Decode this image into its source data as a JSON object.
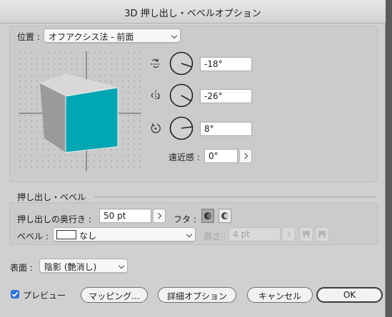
{
  "window": {
    "title": "3D 押し出し・ベベルオプション"
  },
  "position": {
    "label": "位置 :",
    "preset": "オフアクシス法 - 前面",
    "rotation_x": "-18°",
    "rotation_y": "-26°",
    "rotation_z": "8°",
    "perspective_label": "遠近感 :",
    "perspective_value": "0°"
  },
  "extrude": {
    "section_title": "押し出し・ベベル",
    "depth_label": "押し出しの奥行き :",
    "depth_value": "50 pt",
    "cap_label": "フタ :",
    "bevel_label": "ベベル :",
    "bevel_value": "なし",
    "height_label": "高さ :",
    "height_value": "4 pt"
  },
  "surface": {
    "label": "表面 :",
    "value": "陰影 (艶消し)"
  },
  "footer": {
    "preview_label": "プレビュー",
    "preview_checked": true,
    "mapping_button": "マッピング...",
    "more_options_button": "詳細オプション",
    "cancel_button": "キャンセル",
    "ok_button": "OK"
  },
  "colors": {
    "cube_front": "#00a6b1",
    "cube_side": "#9a9a9a",
    "cube_top": "#d8d8d8",
    "accent": "#2f74d9"
  }
}
